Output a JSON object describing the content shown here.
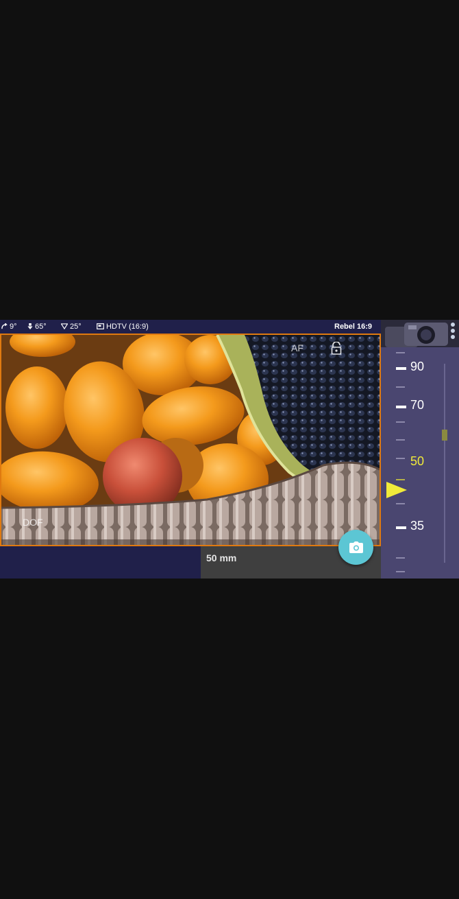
{
  "status_bar": {
    "tilt": "9°",
    "pitch": "65°",
    "angle_of_view": "25°",
    "aspect": "HDTV (16:9)",
    "camera": "Rebel 16:9"
  },
  "viewfinder": {
    "af_label": "AF",
    "dof_label": "DOF"
  },
  "focal_length": {
    "label": "50 mm"
  },
  "dial": {
    "numbers": [
      "90",
      "70",
      "50",
      "35"
    ],
    "selected": "50"
  },
  "icons": {
    "tilt": "tilt-icon",
    "pitch": "pitch-icon",
    "angle_of_view": "angle-of-view-icon",
    "aspect": "aspect-ratio-icon",
    "lock": "unlock-icon",
    "shutter": "camera-icon",
    "menu": "more-vert-icon"
  },
  "colors": {
    "frame_border": "#e07a10",
    "shutter_button": "#5cc6d4",
    "dial_active": "#f0ea3a",
    "top_bar": "#20204a",
    "side_panel": "#4a4670"
  }
}
